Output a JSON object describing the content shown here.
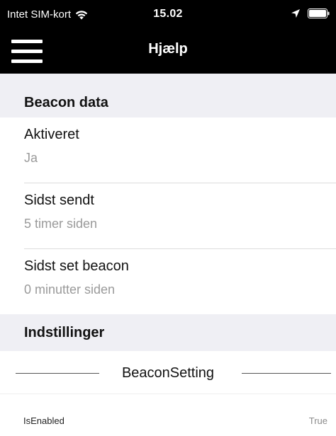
{
  "status_bar": {
    "carrier": "Intet SIM-kort",
    "time": "15.02",
    "wifi_icon": "wifi-icon",
    "location_icon": "location-arrow-icon",
    "battery_icon": "battery-icon"
  },
  "nav": {
    "title": "Hjælp",
    "menu_icon": "hamburger-menu-icon"
  },
  "sections": {
    "beacon_data": {
      "header": "Beacon data",
      "rows": [
        {
          "title": "Aktiveret",
          "value": "Ja"
        },
        {
          "title": "Sidst sendt",
          "value": "5 timer siden"
        },
        {
          "title": "Sidst set beacon",
          "value": "0 minutter siden"
        }
      ]
    },
    "settings": {
      "header": "Indstillinger",
      "group_title": "BeaconSetting",
      "items": [
        {
          "key": "IsEnabled",
          "value": "True"
        }
      ]
    }
  },
  "colors": {
    "nav_background": "#000000",
    "section_background": "#efeff4",
    "secondary_text": "#9a9a9a"
  }
}
